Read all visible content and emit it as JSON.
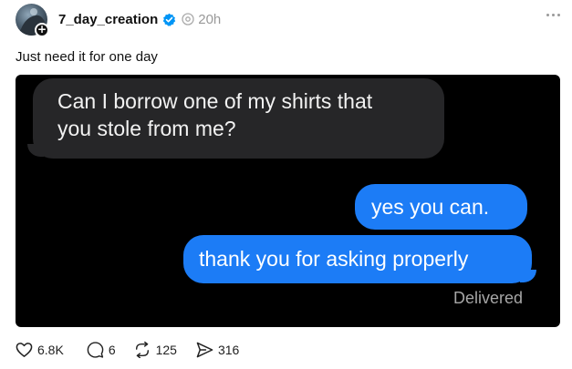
{
  "post": {
    "username": "7_day_creation",
    "time": "20h",
    "caption": "Just need it for one day",
    "image": {
      "incoming_line1": "Can I borrow one of my shirts that",
      "incoming_line2": "you stole from me?",
      "outgoing_1": "yes you can.",
      "outgoing_2": "thank you for asking properly",
      "status": "Delivered"
    },
    "actions": {
      "likes": "6.8K",
      "comments": "6",
      "reposts": "125",
      "shares": "316"
    }
  },
  "colors": {
    "imessage_blue": "#1c7cf6",
    "incoming_gray": "#262628",
    "verified_blue": "#0095f6"
  },
  "icons": [
    "verified-icon",
    "threads-icon",
    "more-icon",
    "heart-icon",
    "comment-icon",
    "repost-icon",
    "share-icon"
  ]
}
